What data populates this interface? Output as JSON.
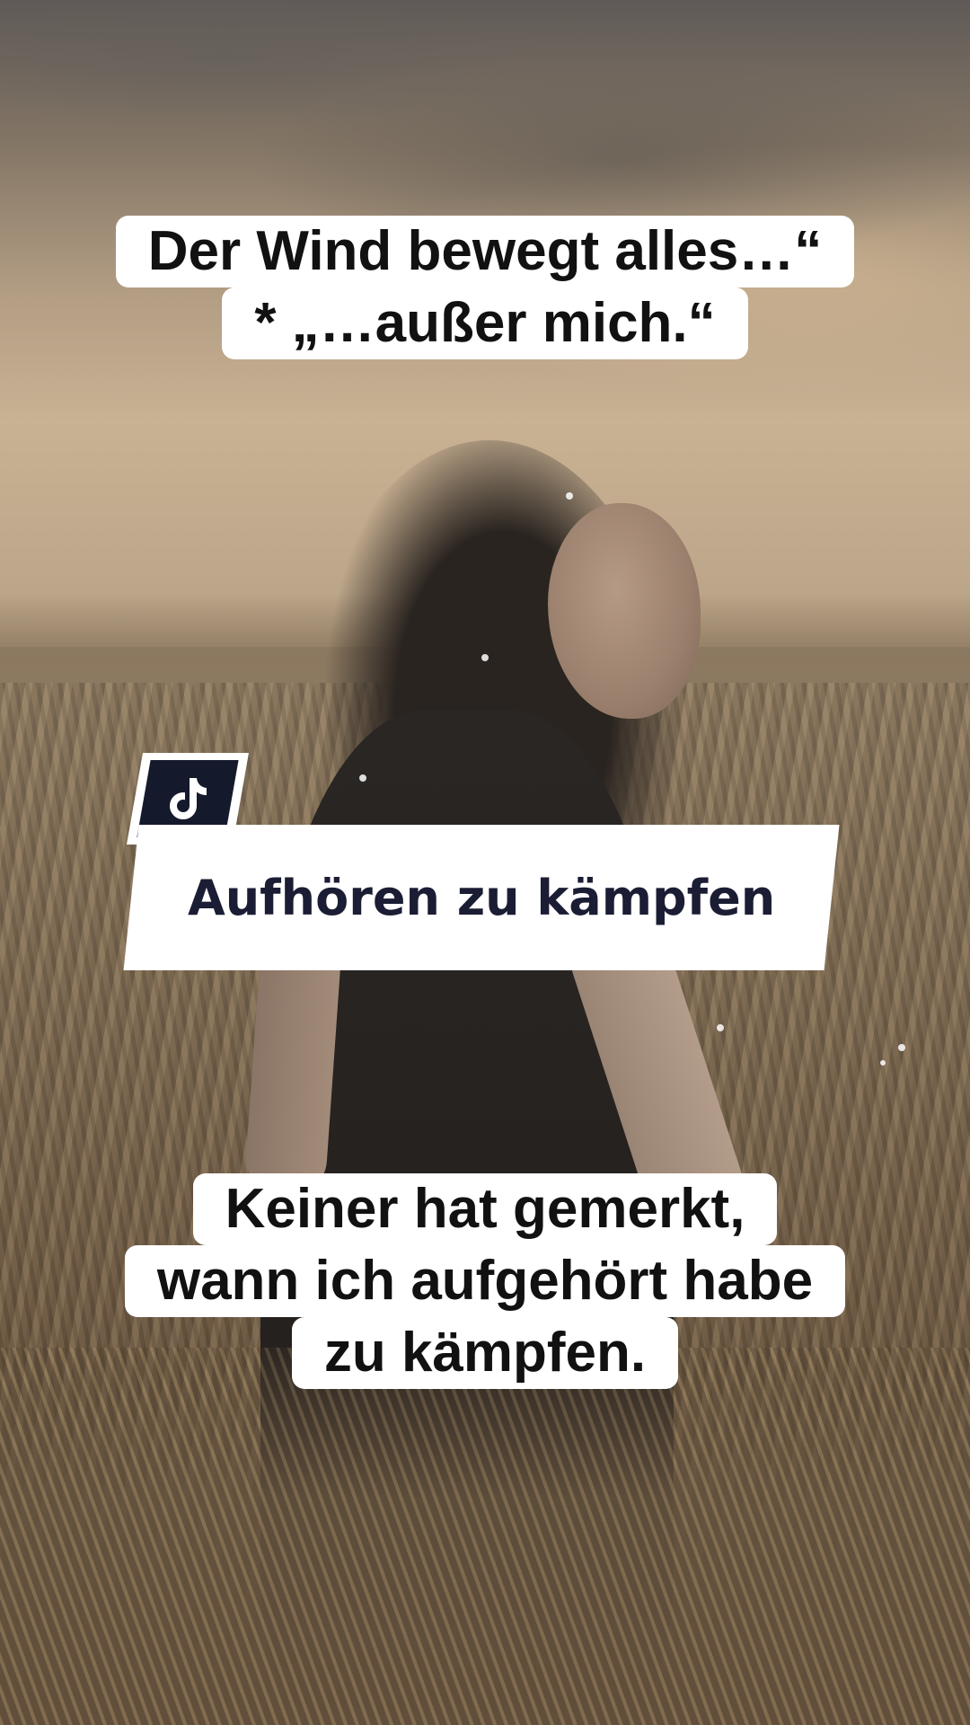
{
  "captions": {
    "top": [
      "Der Wind bewegt alles…“",
      "* „…außer mich.“"
    ],
    "bottom": [
      "Keiner hat gemerkt,",
      "wann ich aufgehört habe",
      "zu kämpfen."
    ]
  },
  "title_card": {
    "icon": "tiktok-logo-icon",
    "title": "Aufhören zu kämpfen"
  },
  "colors": {
    "caption_bg": "#ffffff",
    "caption_text": "#111111",
    "badge_bg": "#15192c",
    "title_text": "#1a1d33"
  }
}
